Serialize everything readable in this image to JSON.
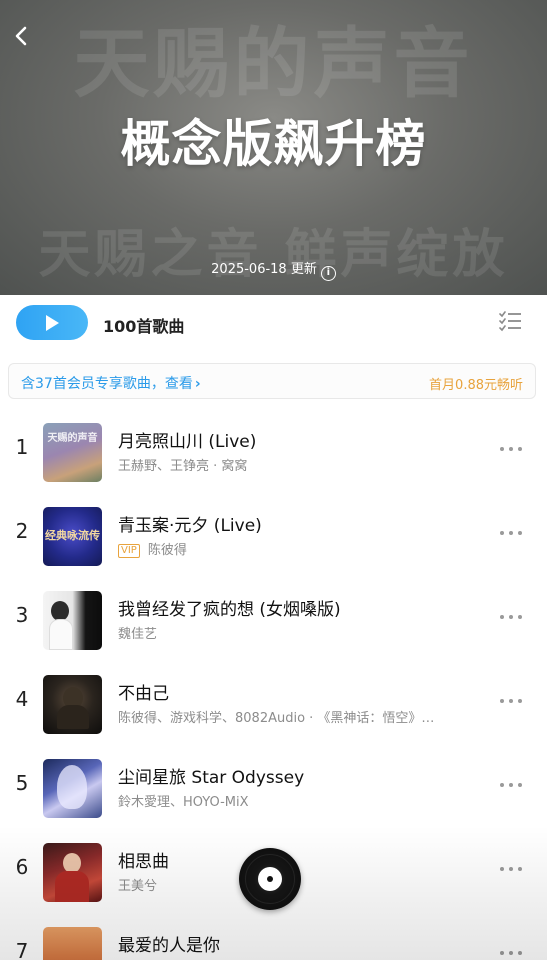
{
  "header": {
    "title": "概念版飙升榜",
    "watermark_top": "天赐的声音",
    "watermark_bottom": "天赐之音 鲜声绽放",
    "updated_date": "2025-06-18 更新",
    "back_icon": "chevron-left-icon",
    "info_icon": "info-icon"
  },
  "toolbar": {
    "song_count": "100首歌曲",
    "play_icon": "play-icon",
    "multiselect_icon": "checklist-icon",
    "accent_color": "#2fa3f3"
  },
  "vip_banner": {
    "text": "含37首会员专享歌曲，查看",
    "chevron": "›",
    "offer": "首月0.88元畅听",
    "offer_color": "#e8a33d"
  },
  "songs": [
    {
      "rank": "1",
      "title": "月亮照山川 (Live)",
      "artists": "王赫野、王铮亮 · 窝窝",
      "vip": "",
      "cover_text": "天赐的声音"
    },
    {
      "rank": "2",
      "title": "青玉案·元夕 (Live)",
      "artists": "陈彼得",
      "vip": "VIP",
      "cover_text": "经典咏流传"
    },
    {
      "rank": "3",
      "title": "我曾经发了疯的想 (女烟嗓版)",
      "artists": "魏佳艺",
      "vip": "",
      "cover_text": ""
    },
    {
      "rank": "4",
      "title": "不由己",
      "artists": "陈彼得、游戏科学、8082Audio · 《黑神话：悟空》…",
      "vip": "",
      "cover_text": ""
    },
    {
      "rank": "5",
      "title": "尘间星旅 Star Odyssey",
      "artists": "鈴木愛理、HOYO-MiX",
      "vip": "",
      "cover_text": ""
    },
    {
      "rank": "6",
      "title": "相思曲",
      "artists": "王美兮",
      "vip": "",
      "cover_text": ""
    },
    {
      "rank": "7",
      "title": "最爱的人是你",
      "artists": "",
      "vip": "",
      "cover_text": ""
    }
  ],
  "mini_player_icon": "vinyl-record-icon"
}
